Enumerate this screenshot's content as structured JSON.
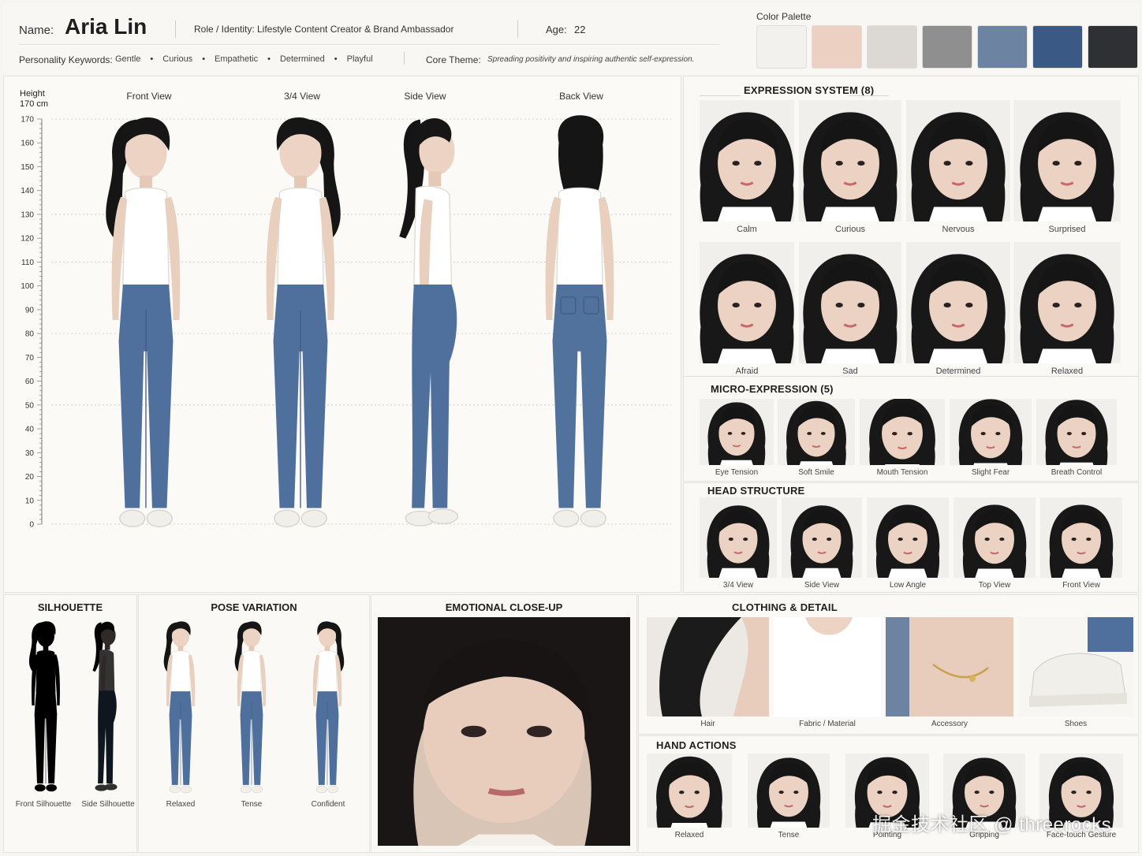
{
  "header": {
    "name_label": "Name:",
    "name": "Aria Lin",
    "role_label": "Role / Identity:",
    "role": "Lifestyle Content Creator & Brand Ambassador",
    "age_label": "Age:",
    "age": "22",
    "keywords_label": "Personality Keywords:",
    "keywords": [
      "Gentle",
      "Curious",
      "Empathetic",
      "Determined",
      "Playful"
    ],
    "theme_label": "Core Theme:",
    "theme": "Spreading positivity and inspiring authentic self-expression."
  },
  "palette": {
    "title": "Color Palette",
    "colors": [
      "#f3f1ed",
      "#ecd0c1",
      "#dcd8d3",
      "#8f8f8f",
      "#6c84a2",
      "#3a5a85",
      "#2f3033"
    ]
  },
  "turnaround": {
    "height_label": "Height",
    "height_value": "170 cm",
    "ruler_ticks": [
      "170",
      "160",
      "150",
      "140",
      "130",
      "120",
      "110",
      "100",
      "90",
      "80",
      "70",
      "60",
      "50",
      "40",
      "30",
      "20",
      "10",
      "0"
    ],
    "views": [
      "Front View",
      "3/4 View",
      "Side View",
      "Back View"
    ]
  },
  "expression": {
    "title": "EXPRESSION SYSTEM (8)",
    "items": [
      "Calm",
      "Curious",
      "Nervous",
      "Surprised",
      "Afraid",
      "Sad",
      "Determined",
      "Relaxed"
    ]
  },
  "micro": {
    "title": "MICRO-EXPRESSION (5)",
    "items": [
      "Eye Tension",
      "Soft Smile",
      "Mouth Tension",
      "Slight Fear",
      "Breath Control"
    ]
  },
  "head": {
    "title": "HEAD STRUCTURE",
    "items": [
      "3/4 View",
      "Side View",
      "Low Angle",
      "Top View",
      "Front View"
    ]
  },
  "silhouette": {
    "title": "SILHOUETTE",
    "items": [
      "Front Silhouette",
      "Side Silhouette"
    ]
  },
  "pose": {
    "title": "POSE VARIATION",
    "items": [
      "Relaxed",
      "Tense",
      "Confident"
    ]
  },
  "closeup": {
    "title": "EMOTIONAL CLOSE-UP"
  },
  "clothing": {
    "title": "CLOTHING & DETAIL",
    "items": [
      "Hair",
      "Fabric / Material",
      "Accessory",
      "Shoes"
    ]
  },
  "hands": {
    "title": "HAND ACTIONS",
    "items": [
      "Relaxed",
      "Tense",
      "Pointing",
      "Gripping",
      "Face-touch Gesture"
    ]
  },
  "watermark": "掘金技术社区 @ threerocks"
}
